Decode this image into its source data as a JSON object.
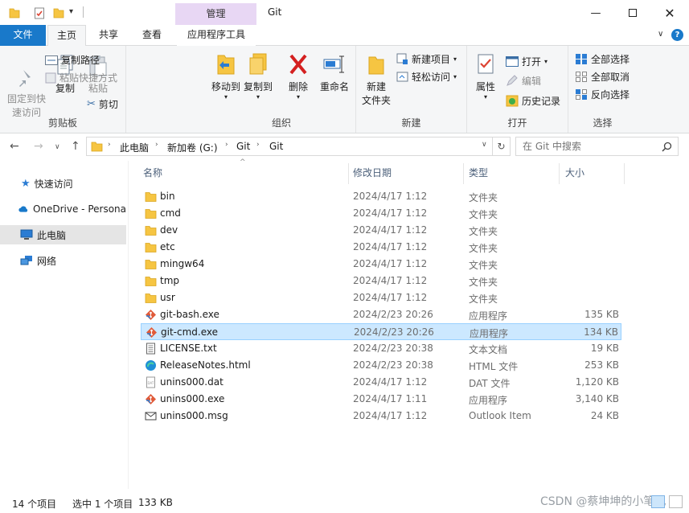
{
  "window": {
    "title": "Git",
    "context_tab": "管理",
    "controls": [
      "minimize",
      "maximize",
      "close"
    ]
  },
  "ribbon_tabs": {
    "file": "文件",
    "home": "主页",
    "share": "共享",
    "view": "查看",
    "app_tools": "应用程序工具"
  },
  "ribbon": {
    "clipboard": {
      "label": "剪贴板",
      "pin": "固定到快\n速访问",
      "copy": "复制",
      "paste": "粘贴",
      "copy_path": "复制路径",
      "paste_shortcut": "粘贴快捷方式",
      "cut": "剪切"
    },
    "organize": {
      "label": "组织",
      "move_to": "移动到",
      "copy_to": "复制到",
      "delete": "删除",
      "rename": "重命名"
    },
    "new": {
      "label": "新建",
      "new_folder": "新建\n文件夹",
      "new_item": "新建项目",
      "easy_access": "轻松访问"
    },
    "open": {
      "label": "打开",
      "properties": "属性",
      "open": "打开",
      "edit": "编辑",
      "history": "历史记录"
    },
    "select": {
      "label": "选择",
      "select_all": "全部选择",
      "select_none": "全部取消",
      "invert": "反向选择"
    }
  },
  "address": {
    "crumbs": [
      "此电脑",
      "新加卷 (G:)",
      "Git",
      "Git"
    ]
  },
  "search": {
    "placeholder": "在 Git 中搜索"
  },
  "sidebar": {
    "items": [
      {
        "label": "快速访问",
        "icon": "star-icon"
      },
      {
        "label": "OneDrive - Persona",
        "icon": "cloud-icon"
      },
      {
        "label": "此电脑",
        "icon": "computer-icon"
      },
      {
        "label": "网络",
        "icon": "network-icon"
      }
    ]
  },
  "columns": {
    "name": "名称",
    "modified": "修改日期",
    "type": "类型",
    "size": "大小"
  },
  "files": [
    {
      "name": "bin",
      "date": "2024/4/17 1:12",
      "type": "文件夹",
      "size": "",
      "icon": "folder"
    },
    {
      "name": "cmd",
      "date": "2024/4/17 1:12",
      "type": "文件夹",
      "size": "",
      "icon": "folder"
    },
    {
      "name": "dev",
      "date": "2024/4/17 1:12",
      "type": "文件夹",
      "size": "",
      "icon": "folder"
    },
    {
      "name": "etc",
      "date": "2024/4/17 1:12",
      "type": "文件夹",
      "size": "",
      "icon": "folder"
    },
    {
      "name": "mingw64",
      "date": "2024/4/17 1:12",
      "type": "文件夹",
      "size": "",
      "icon": "folder"
    },
    {
      "name": "tmp",
      "date": "2024/4/17 1:12",
      "type": "文件夹",
      "size": "",
      "icon": "folder"
    },
    {
      "name": "usr",
      "date": "2024/4/17 1:12",
      "type": "文件夹",
      "size": "",
      "icon": "folder"
    },
    {
      "name": "git-bash.exe",
      "date": "2024/2/23 20:26",
      "type": "应用程序",
      "size": "135 KB",
      "icon": "git"
    },
    {
      "name": "git-cmd.exe",
      "date": "2024/2/23 20:26",
      "type": "应用程序",
      "size": "134 KB",
      "icon": "git",
      "selected": true
    },
    {
      "name": "LICENSE.txt",
      "date": "2024/2/23 20:38",
      "type": "文本文档",
      "size": "19 KB",
      "icon": "text"
    },
    {
      "name": "ReleaseNotes.html",
      "date": "2024/2/23 20:38",
      "type": "HTML 文件",
      "size": "253 KB",
      "icon": "edge"
    },
    {
      "name": "unins000.dat",
      "date": "2024/4/17 1:12",
      "type": "DAT 文件",
      "size": "1,120 KB",
      "icon": "dat"
    },
    {
      "name": "unins000.exe",
      "date": "2024/4/17 1:11",
      "type": "应用程序",
      "size": "3,140 KB",
      "icon": "git"
    },
    {
      "name": "unins000.msg",
      "date": "2024/4/17 1:12",
      "type": "Outlook Item",
      "size": "24 KB",
      "icon": "mail"
    }
  ],
  "status": {
    "count": "14 个项目",
    "selection": "选中 1 个项目",
    "size": "133 KB"
  },
  "watermark": "CSDN @蔡坤坤的小笔记"
}
